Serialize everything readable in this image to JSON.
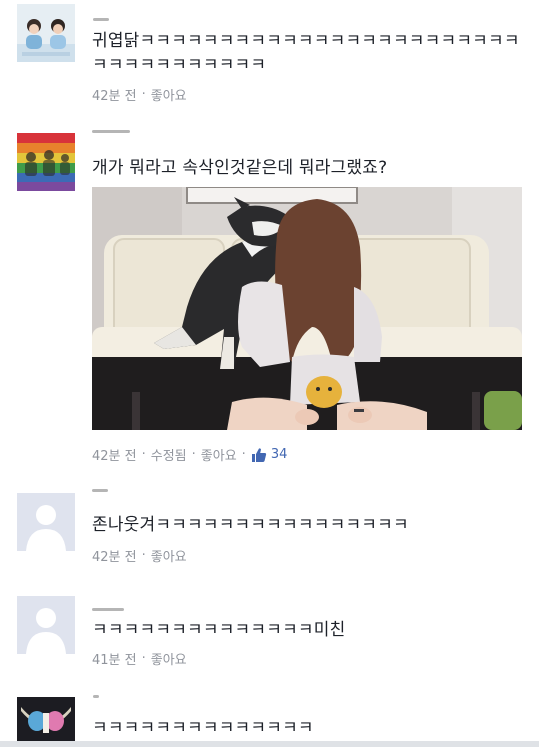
{
  "comments": [
    {
      "text": "귀엽닭ㅋㅋㅋㅋㅋㅋㅋㅋㅋㅋㅋㅋㅋㅋㅋㅋㅋㅋㅋㅋㅋㅋㅋㅋㅋㅋㅋㅋㅋㅋㅋㅋㅋㅋㅋ",
      "time": "42분 전",
      "like": "좋아요"
    },
    {
      "text": "개가 뭐라고 속삭인것같은데 뭐라그랬죠?",
      "time": "42분 전",
      "edited": "수정됨",
      "like": "좋아요",
      "like_count": "34"
    },
    {
      "text": "존나웃겨ㅋㅋㅋㅋㅋㅋㅋㅋㅋㅋㅋㅋㅋㅋㅋㅋ",
      "time": "42분 전",
      "like": "좋아요"
    },
    {
      "text": "ㅋㅋㅋㅋㅋㅋㅋㅋㅋㅋㅋㅋㅋㅋ미친",
      "time": "41분 전",
      "like": "좋아요"
    },
    {
      "text": "ㅋㅋㅋㅋㅋㅋㅋㅋㅋㅋㅋㅋㅋㅋ"
    }
  ],
  "separator": "·",
  "colors": {
    "text": "#1d2129",
    "meta": "#90949c",
    "link": "#90949c",
    "like_icon": "#4267b2",
    "divider": "#dfe2e6",
    "avatar_placeholder": "#c4c9d2"
  },
  "icons": {
    "like_count_icon": "thumbs-up-icon",
    "default_avatar": "person-silhouette-icon"
  }
}
